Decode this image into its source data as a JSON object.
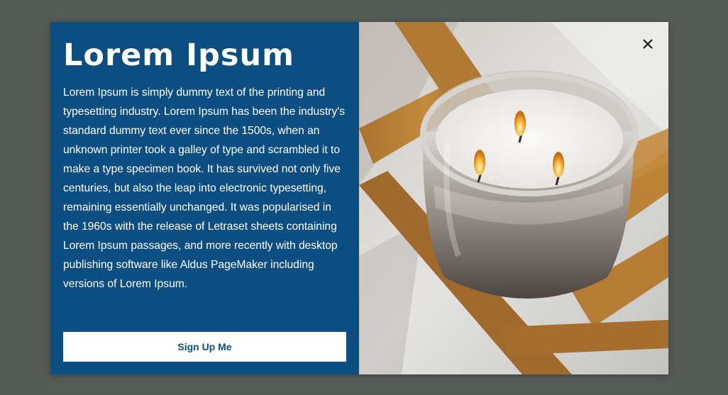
{
  "modal": {
    "title": "Lorem Ipsum",
    "body": "Lorem Ipsum is simply dummy text of the printing and typesetting industry. Lorem Ipsum has been the industry's standard dummy text ever since the 1500s, when an unknown printer took a galley of type and scrambled it to make a type specimen book. It has survived not only five centuries, but also the leap into electronic typesetting, remaining essentially unchanged. It was popularised in the 1960s with the release of Letraset sheets containing Lorem Ipsum passages, and more recently with desktop publishing software like Aldus PageMaker including versions of Lorem Ipsum.",
    "cta_label": "Sign Up Me",
    "close_icon": "close-icon",
    "image_subject": "candle-image"
  },
  "colors": {
    "overlay": "#555b57",
    "panel": "#0c4e82",
    "button_bg": "#ffffff",
    "button_text": "#0c4e82"
  }
}
